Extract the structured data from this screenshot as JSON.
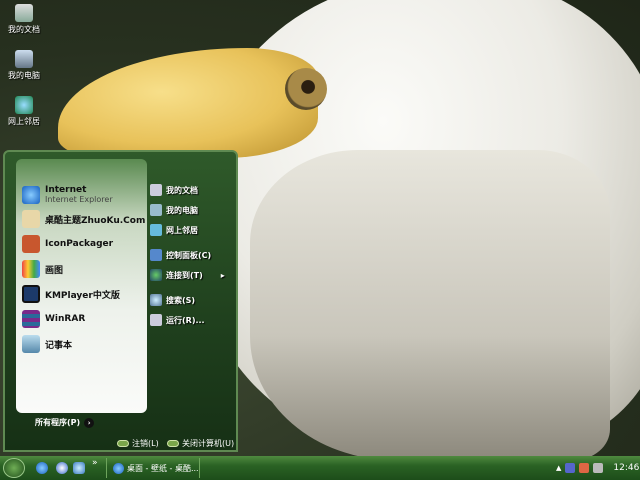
{
  "desktop": {
    "icons": [
      {
        "label": "我的文档"
      },
      {
        "label": "我的电脑"
      },
      {
        "label": "网上邻居"
      }
    ]
  },
  "start_menu": {
    "pinned": [
      {
        "label": "Internet",
        "sub": "Internet Explorer",
        "icon": "ie-icon"
      }
    ],
    "programs": [
      {
        "label": "桌酷主题ZhuoKu.Com",
        "icon": "zhuoku-icon"
      },
      {
        "label": "IconPackager",
        "icon": "iconpackager-icon"
      },
      {
        "label": "画图",
        "icon": "paint-icon"
      },
      {
        "label": "KMPlayer中文版",
        "icon": "kmplayer-icon"
      },
      {
        "label": "WinRAR",
        "icon": "winrar-icon"
      },
      {
        "label": "记事本",
        "icon": "notepad-icon"
      }
    ],
    "all_programs": "所有程序(P)",
    "right": [
      {
        "label": "我的文档",
        "icon": "documents-icon"
      },
      {
        "label": "我的电脑",
        "icon": "computer-icon"
      },
      {
        "label": "网上邻居",
        "icon": "network-icon"
      },
      {
        "label": "控制面板(C)",
        "icon": "control-panel-icon"
      },
      {
        "label": "连接到(T)",
        "icon": "connect-icon"
      },
      {
        "label": "搜索(S)",
        "icon": "search-icon"
      },
      {
        "label": "运行(R)...",
        "icon": "run-icon"
      }
    ],
    "logoff": "注销(L)",
    "shutdown": "关闭计算机(U)"
  },
  "taskbar": {
    "overflow": "»",
    "task": "桌面 - 壁纸 - 桌酷...",
    "clock": "12:46"
  },
  "colors": {
    "taskbar": "#2a6224",
    "menu": "#1f3f1d"
  }
}
